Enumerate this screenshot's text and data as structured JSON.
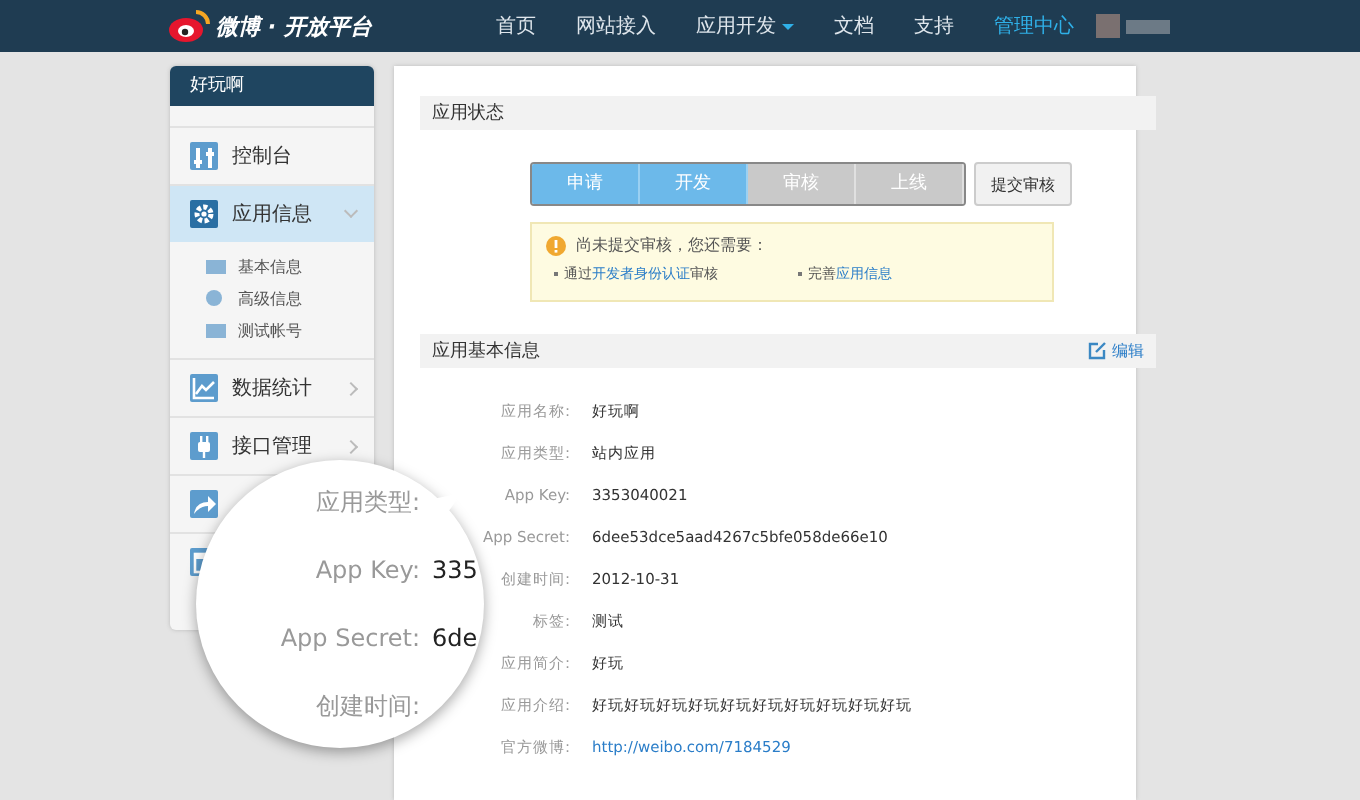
{
  "topbar": {
    "logo": "微博 · 开放平台",
    "nav": [
      {
        "label": "首页",
        "selected": false,
        "caret": false
      },
      {
        "label": "网站接入",
        "selected": false,
        "caret": false
      },
      {
        "label": "应用开发",
        "selected": false,
        "caret": true
      },
      {
        "label": "文档",
        "selected": false,
        "caret": false
      },
      {
        "label": "支持",
        "selected": false,
        "caret": false
      },
      {
        "label": "管理中心",
        "selected": true,
        "caret": false
      }
    ]
  },
  "sidebar": {
    "title": "好玩啊",
    "items": [
      {
        "label": "控制台",
        "selected": false
      },
      {
        "label": "应用信息",
        "selected": true,
        "expanded": true,
        "children": [
          {
            "label": "基本信息"
          },
          {
            "label": "高级信息"
          },
          {
            "label": "测试帐号"
          }
        ]
      },
      {
        "label": "数据统计",
        "selected": false,
        "expanded": false
      },
      {
        "label": "接口管理",
        "selected": false,
        "expanded": false
      },
      {
        "selected": false
      },
      {
        "selected": false
      }
    ]
  },
  "status": {
    "title": "应用状态",
    "steps": [
      {
        "label": "申请",
        "done": true
      },
      {
        "label": "开发",
        "done": true
      },
      {
        "label": "审核",
        "done": false
      },
      {
        "label": "上线",
        "done": false
      }
    ],
    "submit_button": "提交审核",
    "notice": {
      "text": "尚未提交审核，您还需要：",
      "todos": [
        {
          "parts": [
            {
              "text": "通过",
              "link": false
            },
            {
              "text": "开发者身份认证",
              "link": true
            },
            {
              "text": "审核",
              "link": false
            }
          ]
        },
        {
          "parts": [
            {
              "text": "完善",
              "link": false
            },
            {
              "text": "应用信息",
              "link": true
            }
          ]
        }
      ]
    }
  },
  "basic_info": {
    "title": "应用基本信息",
    "edit_link": "编辑",
    "fields": [
      {
        "label": "应用名称:",
        "value": "好玩啊",
        "link": false
      },
      {
        "label": "应用类型:",
        "value": "站内应用",
        "link": false
      },
      {
        "label": "App Key:",
        "value": "3353040021",
        "link": false
      },
      {
        "label": "App Secret:",
        "value": "6dee53dce5aad4267c5bfe058de66e10",
        "link": false
      },
      {
        "label": "创建时间:",
        "value": "2012-10-31",
        "link": false
      },
      {
        "label": "标签:",
        "value": "测试",
        "link": false
      },
      {
        "label": "应用简介:",
        "value": "好玩",
        "link": false
      },
      {
        "label": "应用介绍:",
        "value": "好玩好玩好玩好玩好玩好玩好玩好玩好玩好玩",
        "link": false
      },
      {
        "label": "官方微博:",
        "value": "http://weibo.com/7184529",
        "link": true
      }
    ]
  },
  "magnifier": {
    "rows": [
      {
        "label": "应用类型:"
      },
      {
        "label": "App Key:",
        "value": "335"
      },
      {
        "label": "App Secret:",
        "value": "6de"
      },
      {
        "label": "创建时间:"
      }
    ]
  }
}
